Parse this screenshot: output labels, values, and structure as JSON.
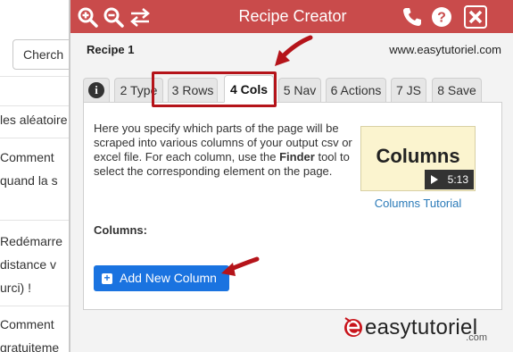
{
  "background": {
    "search_text": "Cherch",
    "rows": [
      {
        "lines": [
          "les aléatoire"
        ]
      },
      {
        "lines": [
          "Comment",
          "quand la s"
        ]
      },
      {
        "lines": [
          "Redémarre",
          "distance v",
          "urci) !"
        ]
      },
      {
        "lines": [
          "Comment",
          "gratuiteme"
        ]
      }
    ]
  },
  "window": {
    "title": "Recipe Creator",
    "titlebar_color": "#c94b4b",
    "left_icons": [
      "zoom-in-icon",
      "zoom-out-icon",
      "swap-arrows-icon"
    ],
    "right_icons": [
      "phone-icon",
      "help-icon",
      "close-icon"
    ]
  },
  "recipe": {
    "name": "Recipe 1",
    "site": "www.easytutoriel.com"
  },
  "tabs": [
    {
      "label": "i",
      "icon": "info-icon",
      "active": false
    },
    {
      "label": "2 Type",
      "active": false
    },
    {
      "label": "3 Rows",
      "active": false
    },
    {
      "label": "4 Cols",
      "active": true
    },
    {
      "label": "5 Nav",
      "active": false
    },
    {
      "label": "6 Actions",
      "active": false
    },
    {
      "label": "7 JS",
      "active": false
    },
    {
      "label": "8 Save",
      "active": false
    }
  ],
  "panel": {
    "description_start": "Here you specify which parts of the page will be scraped into various columns of your output csv or excel file. For each column, use the ",
    "description_bold": "Finder",
    "description_end": " tool to select the corresponding element on the page.",
    "video": {
      "title": "Columns",
      "duration": "5:13",
      "link": "Columns Tutorial"
    },
    "columns_label": "Columns:",
    "add_button": "Add New Column",
    "accent_color": "#1a73e0"
  },
  "logo": {
    "text": "easytutoriel",
    "suffix": ".com"
  },
  "annotation_color": "#b5141a"
}
